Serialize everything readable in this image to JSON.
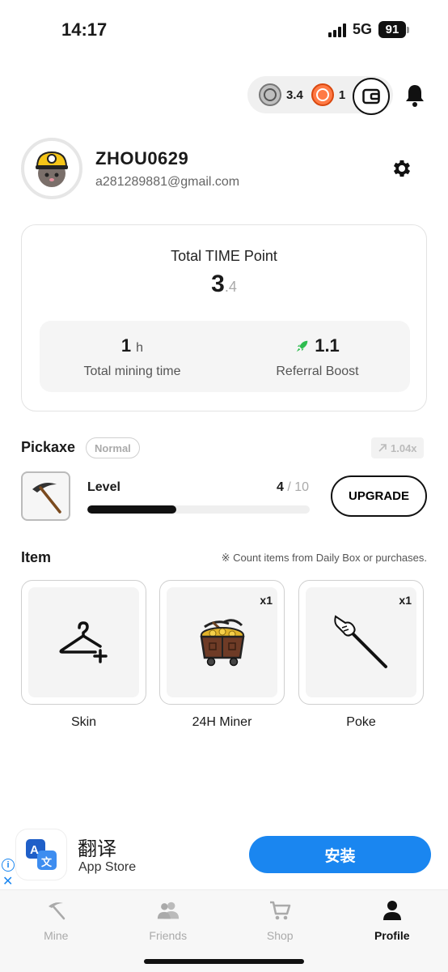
{
  "status_bar": {
    "time": "14:17",
    "network": "5G",
    "battery": "91"
  },
  "balance": {
    "time_points": "3.4",
    "clock_count": "1"
  },
  "profile": {
    "username": "ZHOU0629",
    "email": "a281289881@gmail.com"
  },
  "total": {
    "title": "Total TIME Point",
    "value_int": "3",
    "value_dec": ".4",
    "mining_time_value": "1",
    "mining_time_unit": "h",
    "mining_time_label": "Total mining time",
    "referral_value": "1.1",
    "referral_label": "Referral Boost"
  },
  "pickaxe": {
    "title": "Pickaxe",
    "grade": "Normal",
    "multiplier": "1.04x",
    "level_label": "Level",
    "level_current": "4",
    "level_sep": " / ",
    "level_max": "10",
    "level_progress": 0.4,
    "upgrade_label": "UPGRADE"
  },
  "items": {
    "title": "Item",
    "note": "※ Count items from Daily Box or purchases.",
    "list": [
      {
        "name": "Skin",
        "qty": "",
        "icon": "hanger-plus-icon"
      },
      {
        "name": "24H Miner",
        "qty": "x1",
        "icon": "mine-cart-icon"
      },
      {
        "name": "Poke",
        "qty": "x1",
        "icon": "poke-stick-icon"
      }
    ]
  },
  "ad": {
    "title": "翻译",
    "subtitle": "App Store",
    "install": "安装",
    "info": "i",
    "close": "✕"
  },
  "nav": [
    {
      "label": "Mine",
      "icon": "pickaxe-icon"
    },
    {
      "label": "Friends",
      "icon": "friends-icon"
    },
    {
      "label": "Shop",
      "icon": "cart-icon"
    },
    {
      "label": "Profile",
      "icon": "person-icon",
      "active": true
    }
  ],
  "colors": {
    "accent": "#1a86f0",
    "referral_green": "#2ebd4f",
    "clock_orange": "#ff7a45"
  }
}
